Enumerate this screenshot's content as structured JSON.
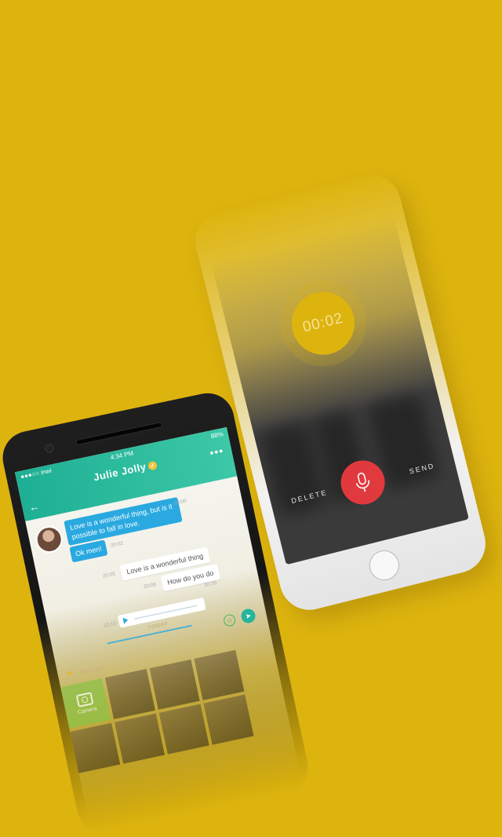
{
  "recorder": {
    "timer": "00:02",
    "delete_label": "DELETE",
    "send_label": "SEND"
  },
  "chat": {
    "status": {
      "carrier": "●●●○○ inwi",
      "time": "4:34 PM",
      "battery": "88%"
    },
    "contact_name": "Julie Jolly",
    "messages": [
      {
        "text": "Love is a wonderful thing, but is it possible to fall in love.",
        "time": "20:00"
      },
      {
        "text": "Ok men!",
        "time": "20:02"
      },
      {
        "text": "Love is a wonderful thing",
        "time": "20:05"
      },
      {
        "text": "How do you do",
        "time": "20:08"
      }
    ],
    "audio_time": "20:30",
    "audio_time_left": "20:10",
    "day_divider": "TODAY",
    "message_placeholder": "Message",
    "camera_label": "Camera"
  },
  "colors": {
    "background": "#DDB40E",
    "accent_green": "#2DBA9A",
    "bubble_blue": "#2AA9E0",
    "record_red": "#E0393E"
  }
}
